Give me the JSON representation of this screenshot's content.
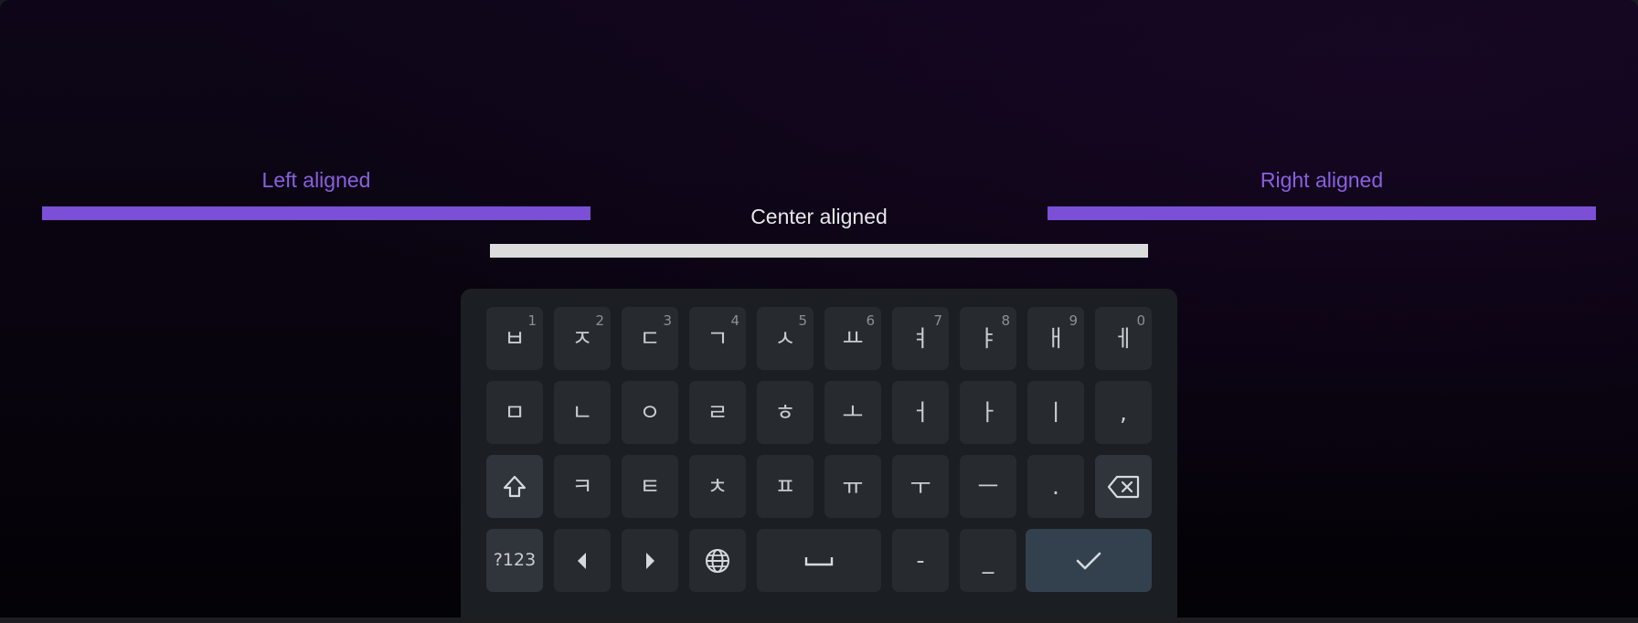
{
  "fields": {
    "left": {
      "label": "Left aligned"
    },
    "center": {
      "label": "Center aligned"
    },
    "right": {
      "label": "Right aligned"
    }
  },
  "colors": {
    "accent": "#7b4fd6",
    "accent_text": "#8a5fe0",
    "center_bar": "#dcdcdc",
    "key_bg": "#272b30",
    "enter_bg": "#33414f"
  },
  "keyboard": {
    "row1": [
      {
        "label": "ㅂ",
        "hint": "1"
      },
      {
        "label": "ㅈ",
        "hint": "2"
      },
      {
        "label": "ㄷ",
        "hint": "3"
      },
      {
        "label": "ㄱ",
        "hint": "4"
      },
      {
        "label": "ㅅ",
        "hint": "5"
      },
      {
        "label": "ㅛ",
        "hint": "6"
      },
      {
        "label": "ㅕ",
        "hint": "7"
      },
      {
        "label": "ㅑ",
        "hint": "8"
      },
      {
        "label": "ㅐ",
        "hint": "9"
      },
      {
        "label": "ㅔ",
        "hint": "0"
      }
    ],
    "row2": [
      "ㅁ",
      "ㄴ",
      "ㅇ",
      "ㄹ",
      "ㅎ",
      "ㅗ",
      "ㅓ",
      "ㅏ",
      "ㅣ",
      ","
    ],
    "row3": [
      "ㅋ",
      "ㅌ",
      "ㅊ",
      "ㅍ",
      "ㅠ",
      "ㅜ",
      "ㅡ",
      "."
    ],
    "row4": {
      "symbols": "?123",
      "dash": "-",
      "underscore": "_"
    },
    "icons": {
      "shift": "shift-icon",
      "backspace": "backspace-icon",
      "left": "arrow-left-icon",
      "right": "arrow-right-icon",
      "globe": "globe-icon",
      "space": "space-icon",
      "enter": "checkmark-icon"
    }
  }
}
